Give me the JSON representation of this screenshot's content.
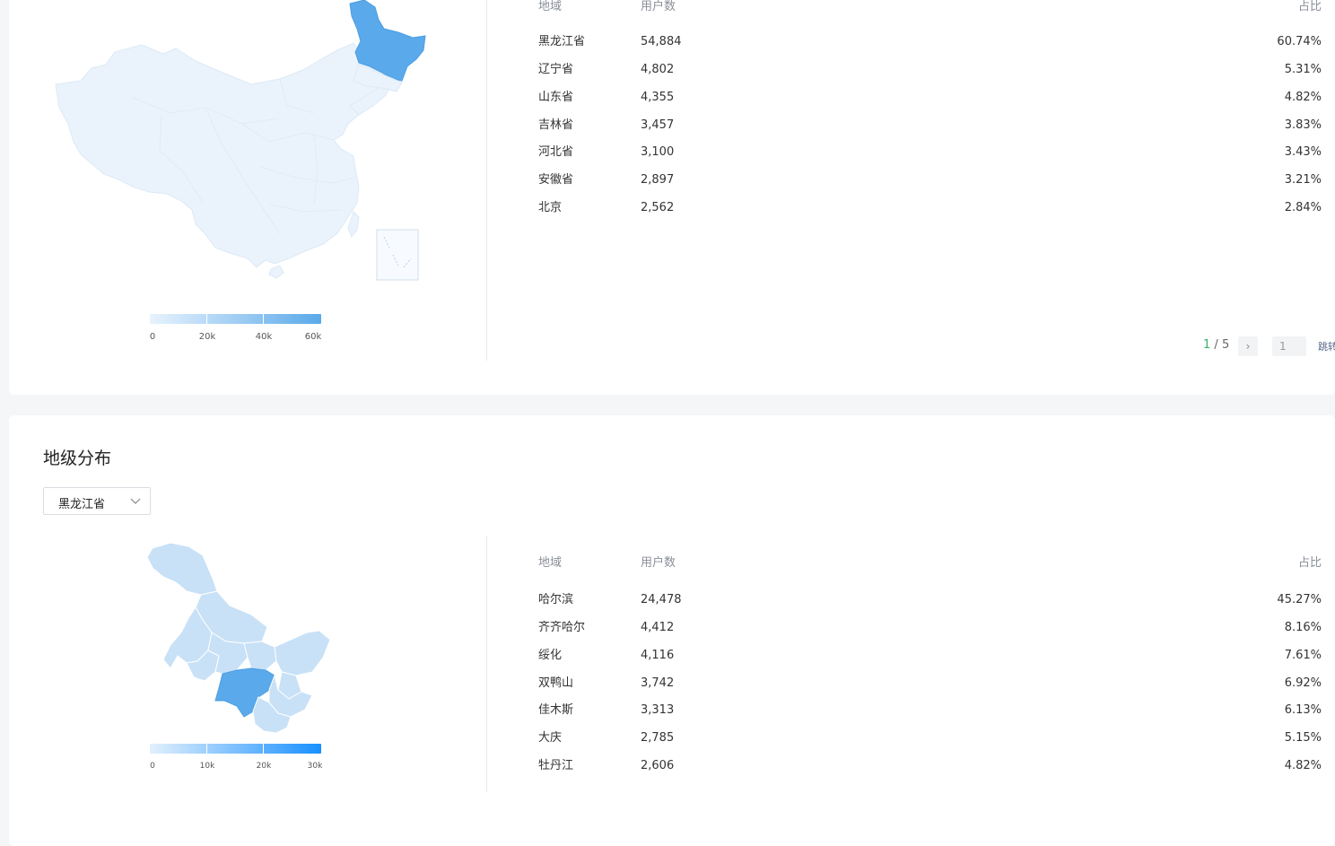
{
  "province_section": {
    "headers": {
      "region": "地域",
      "users": "用户数",
      "share": "占比"
    },
    "rows": [
      {
        "region": "黑龙江省",
        "users": "54,884",
        "share": "60.74%"
      },
      {
        "region": "辽宁省",
        "users": "4,802",
        "share": "5.31%"
      },
      {
        "region": "山东省",
        "users": "4,355",
        "share": "4.82%"
      },
      {
        "region": "吉林省",
        "users": "3,457",
        "share": "3.83%"
      },
      {
        "region": "河北省",
        "users": "3,100",
        "share": "3.43%"
      },
      {
        "region": "安徽省",
        "users": "2,897",
        "share": "3.21%"
      },
      {
        "region": "北京",
        "users": "2,562",
        "share": "2.84%"
      }
    ],
    "legend": {
      "labels": [
        "0",
        "20k",
        "40k",
        "60k"
      ],
      "color_low": "#e8f3fd",
      "color_high": "#5aa9ea"
    },
    "pager": {
      "current": "1",
      "separator": " / ",
      "total": "5",
      "next_glyph": "›",
      "input_value": "1",
      "jump_label": "跳转"
    },
    "map_colors": {
      "base": "#eaf3fc",
      "highlight": "#5aa9ea",
      "border": "#dde9f5"
    }
  },
  "city_section": {
    "title": "地级分布",
    "select": {
      "value": "黑龙江省"
    },
    "headers": {
      "region": "地域",
      "users": "用户数",
      "share": "占比"
    },
    "rows": [
      {
        "region": "哈尔滨",
        "users": "24,478",
        "share": "45.27%"
      },
      {
        "region": "齐齐哈尔",
        "users": "4,412",
        "share": "8.16%"
      },
      {
        "region": "绥化",
        "users": "4,116",
        "share": "7.61%"
      },
      {
        "region": "双鸭山",
        "users": "3,742",
        "share": "6.92%"
      },
      {
        "region": "佳木斯",
        "users": "3,313",
        "share": "6.13%"
      },
      {
        "region": "大庆",
        "users": "2,785",
        "share": "5.15%"
      },
      {
        "region": "牡丹江",
        "users": "2,606",
        "share": "4.82%"
      }
    ],
    "legend": {
      "labels": [
        "0",
        "10k",
        "20k",
        "30k"
      ],
      "color_low": "#e2f0fc",
      "color_high": "#1890ff"
    },
    "map_colors": {
      "base": "#c8e1f7",
      "highlight": "#5aa9ea",
      "border": "#ffffff"
    }
  }
}
